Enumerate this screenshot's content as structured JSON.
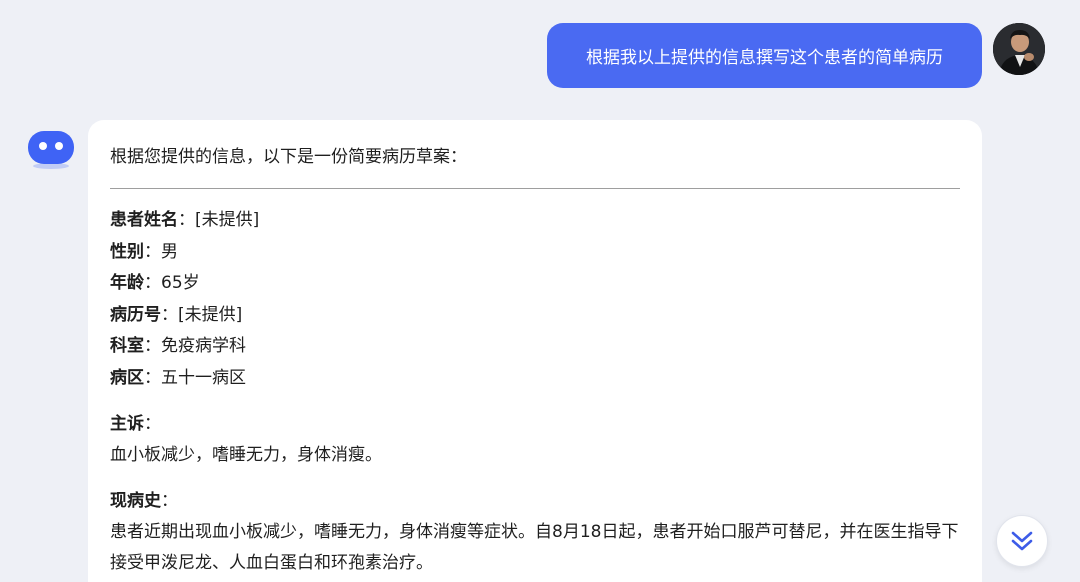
{
  "user_message": {
    "text": "根据我以上提供的信息撰写这个患者的简单病历"
  },
  "bot_message": {
    "intro": "根据您提供的信息，以下是一份简要病历草案：",
    "fields": [
      {
        "key": "患者姓名",
        "sep": "：",
        "value": "[未提供]"
      },
      {
        "key": "性别",
        "sep": "：",
        "value": "男"
      },
      {
        "key": "年龄",
        "sep": "：",
        "value": "65岁"
      },
      {
        "key": "病历号",
        "sep": "：",
        "value": "[未提供]"
      },
      {
        "key": "科室",
        "sep": "：",
        "value": "免疫病学科"
      },
      {
        "key": "病区",
        "sep": "：",
        "value": "五十一病区"
      }
    ],
    "chief_complaint": {
      "title": "主诉",
      "sep": "：",
      "text": "血小板减少，嗜睡无力，身体消瘦。"
    },
    "present_illness": {
      "title": "现病史",
      "sep": "：",
      "text": "患者近期出现血小板减少，嗜睡无力，身体消瘦等症状。自8月18日起，患者开始口服芦可替尼，并在医生指导下接受甲泼尼龙、人血白蛋白和环孢素治疗。"
    }
  },
  "icons": {
    "bot_avatar": "bot-face-icon",
    "user_avatar": "user-photo-avatar",
    "scroll_down": "double-chevron-down-icon"
  },
  "colors": {
    "background": "#eef0f6",
    "user_bubble": "#4a6af2",
    "bot_avatar": "#3f63f5",
    "scroll_icon": "#3d5ce8"
  }
}
